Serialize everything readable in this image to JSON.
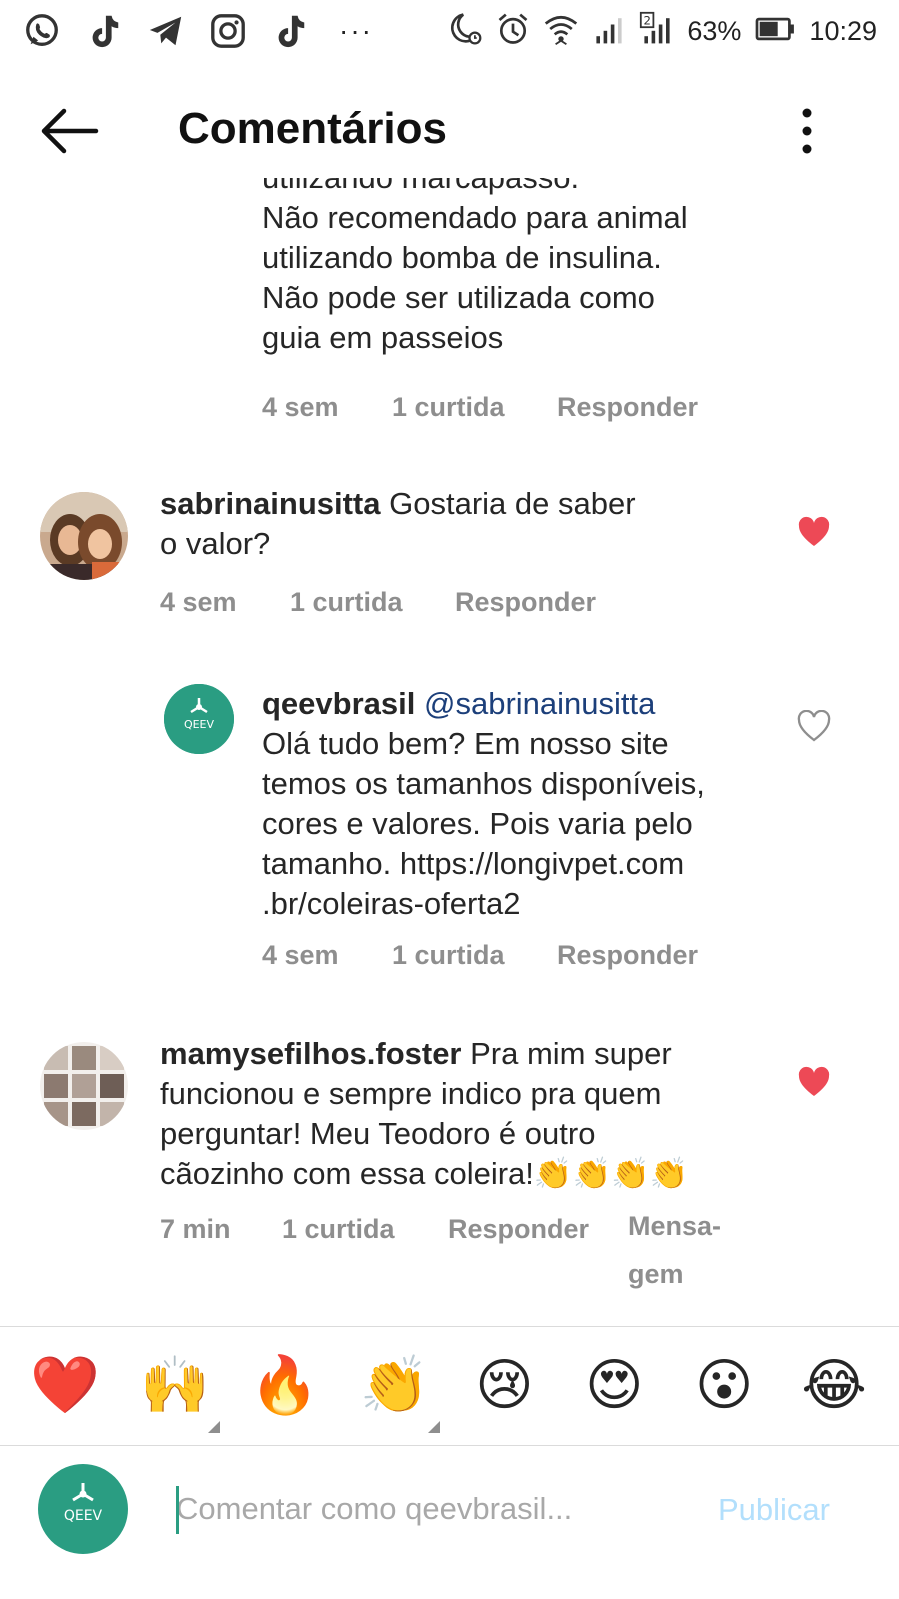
{
  "status_bar": {
    "left_icons": [
      "whatsapp-icon",
      "tiktok-icon",
      "telegram-icon",
      "instagram-icon",
      "tiktok-icon"
    ],
    "more": "···",
    "battery": "63%",
    "time": "10:29",
    "sim1": "1",
    "sim2": "2"
  },
  "header": {
    "title": "Comentários"
  },
  "comments": [
    {
      "text_lines": [
        "utilizando marcapasso.",
        "Não recomendado para animal",
        "utilizando bomba de insulina.",
        "Não pode ser utilizada como",
        "guia em passeios"
      ],
      "time": "4 sem",
      "likes": "1 curtida",
      "reply": "Responder"
    },
    {
      "username": "sabrinainusitta",
      "text_first": " Gostaria de saber",
      "text_second": "o valor?",
      "time": "4 sem",
      "likes": "1 curtida",
      "reply": "Responder",
      "liked": true
    },
    {
      "username": "qeevbrasil",
      "mention": "@sabrinainusitta",
      "text_lines": [
        "Olá tudo bem? Em nosso site",
        "temos os tamanhos disponíveis,",
        "cores e valores. Pois varia pelo",
        "tamanho.  https://longivpet.com",
        ".br/coleiras-oferta2"
      ],
      "time": "4 sem",
      "likes": "1 curtida",
      "reply": "Responder",
      "liked": false,
      "avatar_text": "QEEV"
    },
    {
      "username": "mamysefilhos.foster",
      "text_first": " Pra mim super",
      "text_lines": [
        "funcionou e sempre indico pra quem",
        "perguntar! Meu Teodoro é outro",
        "cãozinho com essa coleira!👏👏👏👏"
      ],
      "time": "7 min",
      "likes": "1 curtida",
      "reply": "Responder",
      "message_line1": "Mensa-",
      "message_line2": "gem",
      "liked": true
    }
  ],
  "emoji_bar": [
    "❤️",
    "🙌",
    "🔥",
    "👏",
    "😢",
    "😍",
    "😮",
    "😂"
  ],
  "input": {
    "placeholder": "Comentar como qeevbrasil...",
    "publish": "Publicar",
    "avatar_text": "QEEV"
  },
  "colors": {
    "brand_teal": "#2a9d82",
    "like_red": "#ed4956",
    "meta_gray": "#8e8e8e",
    "mention_blue": "#1c3f7a",
    "publish_disabled": "#b2dffc"
  }
}
